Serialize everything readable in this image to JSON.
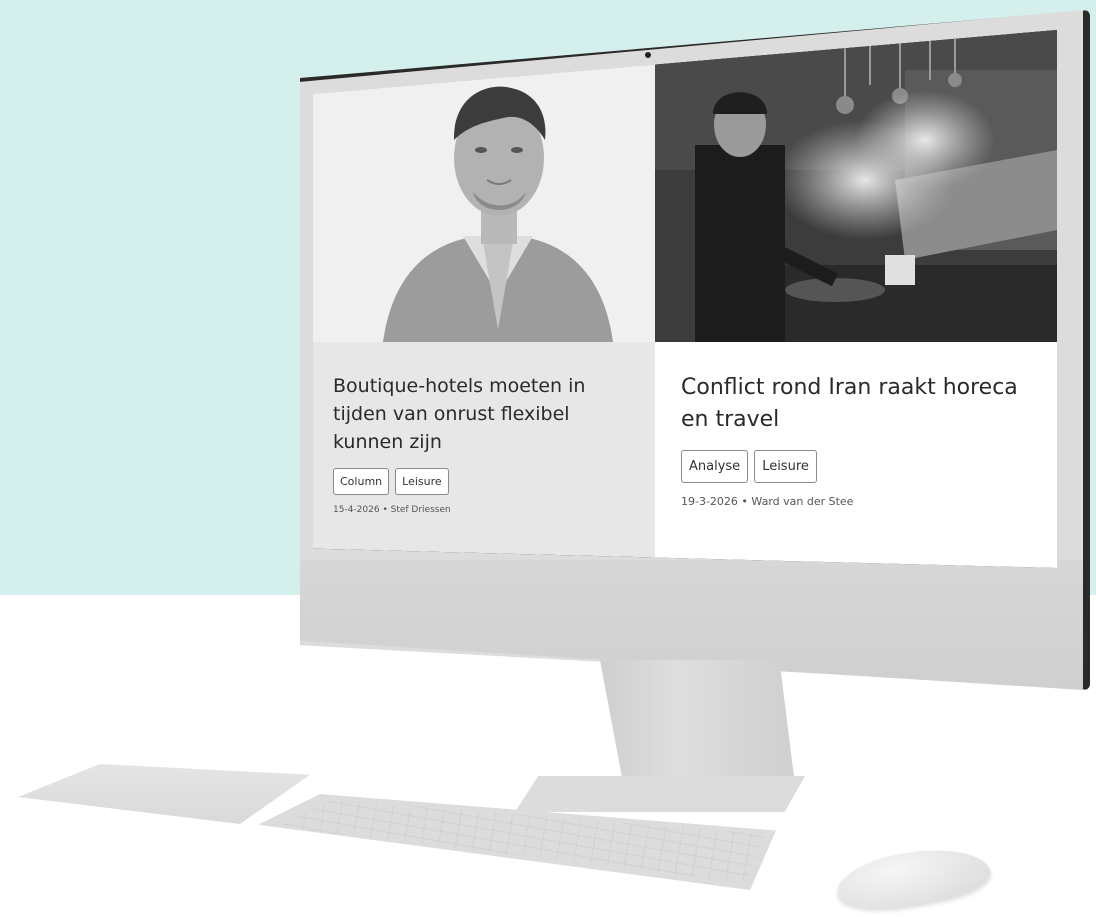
{
  "articles": [
    {
      "title": "Boutique-hotels moeten in tijden van onrust flexibel kunnen zijn",
      "tags": [
        "Column",
        "Leisure"
      ],
      "meta": "15-4-2026 • Stef Driessen",
      "image": "portrait-photo"
    },
    {
      "title": "Conflict rond Iran raakt horeca en travel",
      "tags": [
        "Analyse",
        "Leisure"
      ],
      "meta": "19-3-2026 • Ward van der Stee",
      "image": "chef-kitchen-photo"
    }
  ],
  "colors": {
    "background_top": "#d4efec",
    "background_bottom": "#ffffff",
    "device": "#dcdcdc"
  }
}
